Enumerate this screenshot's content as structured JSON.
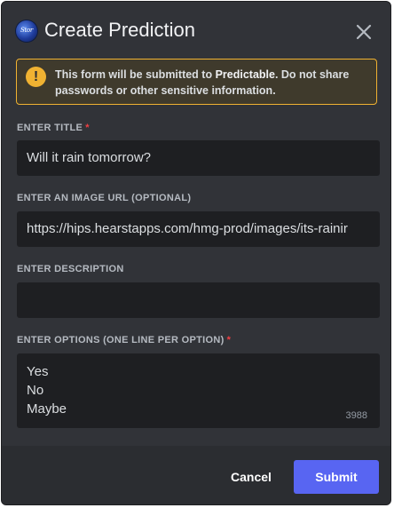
{
  "modal": {
    "title": "Create Prediction",
    "app_logo_text": "Stor"
  },
  "notice": {
    "text_before": "This form will be submitted to ",
    "app_name": "Predictable",
    "text_after": ". Do not share passwords or other sensitive information."
  },
  "fields": {
    "title": {
      "label": "ENTER TITLE",
      "required_mark": "*",
      "value": "Will it rain tomorrow?"
    },
    "image_url": {
      "label": "ENTER AN IMAGE URL (OPTIONAL)",
      "value": "https://hips.hearstapps.com/hmg-prod/images/its-rainir"
    },
    "description": {
      "label": "ENTER DESCRIPTION",
      "value": ""
    },
    "options": {
      "label": "ENTER OPTIONS (ONE LINE PER OPTION)",
      "required_mark": "*",
      "lines": [
        "Yes",
        "No",
        "Maybe"
      ],
      "remaining_chars": "3988"
    }
  },
  "footer": {
    "cancel_label": "Cancel",
    "submit_label": "Submit"
  },
  "colors": {
    "background": "#313338",
    "input_bg": "#1e1f22",
    "warning": "#f0b232",
    "required": "#f23f43",
    "primary_button": "#5865f2"
  }
}
